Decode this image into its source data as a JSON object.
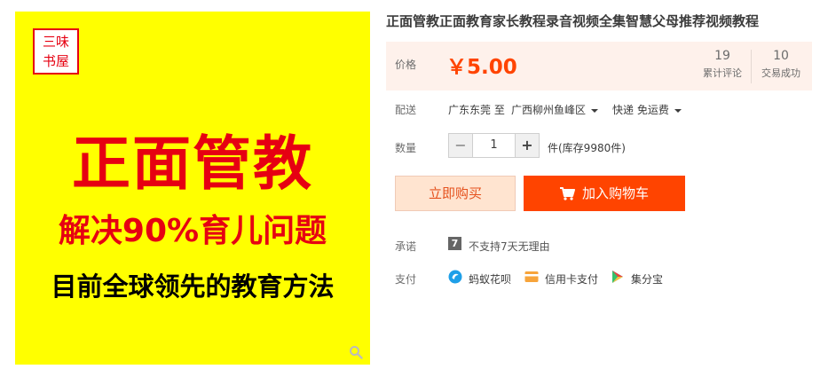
{
  "image": {
    "seal_line1": "三味",
    "seal_line2": "书屋",
    "headline": "正面管教",
    "subline1": "解决90%育儿问题",
    "subline2": "目前全球领先的教育方法"
  },
  "product": {
    "title": "正面管教正面教育家长教程录音视频全集智慧父母推荐视频教程"
  },
  "price": {
    "label": "价格",
    "value": "￥5.00",
    "reviews_count": "19",
    "reviews_label": "累计评论",
    "trades_count": "10",
    "trades_label": "交易成功"
  },
  "delivery": {
    "label": "配送",
    "from": "广东东莞 至",
    "to": "广西柳州鱼峰区",
    "shipping": "快递 免运费"
  },
  "quantity": {
    "label": "数量",
    "minus": "−",
    "value": "1",
    "plus": "+",
    "stock": "件(库存9980件)"
  },
  "actions": {
    "buy_now": "立即购买",
    "add_to_cart": "加入购物车"
  },
  "promise": {
    "label": "承诺",
    "icon_text": "7",
    "text": "不支持7天无理由"
  },
  "payment": {
    "label": "支付",
    "methods": [
      {
        "name": "蚂蚁花呗",
        "icon": "huabei-icon"
      },
      {
        "name": "信用卡支付",
        "icon": "credit-card-icon"
      },
      {
        "name": "集分宝",
        "icon": "jifenbao-icon"
      }
    ]
  },
  "colors": {
    "accent": "#ff4400",
    "image_bg": "#ffff00",
    "image_text_red": "#e60012"
  }
}
